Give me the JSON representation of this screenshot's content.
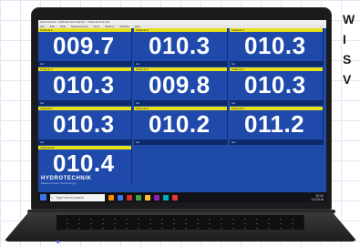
{
  "app": {
    "title_bar": "Hydrotechnik - HMG Remote Monitor - Channel Overview",
    "menu": [
      "File",
      "Edit",
      "View",
      "Measurement",
      "Tools",
      "Options",
      "Window",
      "Help"
    ]
  },
  "tiles": [
    {
      "header": "Channel 1",
      "value": "009.7",
      "unit": "bar"
    },
    {
      "header": "Channel 2",
      "value": "010.3",
      "unit": "bar"
    },
    {
      "header": "Channel 3",
      "value": "010.3",
      "unit": "bar"
    },
    {
      "header": "Channel 4",
      "value": "010.3",
      "unit": "bar"
    },
    {
      "header": "Channel 5",
      "value": "009.8",
      "unit": "bar"
    },
    {
      "header": "Channel 6",
      "value": "010.3",
      "unit": "bar"
    },
    {
      "header": "Channel 7",
      "value": "010.3",
      "unit": "bar"
    },
    {
      "header": "Channel 8",
      "value": "010.2",
      "unit": "bar"
    },
    {
      "header": "Channel 9",
      "value": "011.2",
      "unit": "bar"
    },
    {
      "header": "Channel 10",
      "value": "010.4",
      "unit": "bar"
    }
  ],
  "logo": {
    "brand": "HYDROTECHNIK",
    "tagline": "Measurement Technology"
  },
  "taskbar": {
    "search_placeholder": "Type here to search",
    "tray_time": "10:24",
    "tray_date": "1/1/2019",
    "app_icon_colors": [
      "#ff8a00",
      "#3b78e7",
      "#d32f2f",
      "#43a047",
      "#fbc02d",
      "#8e24aa",
      "#00acc1",
      "#e53935"
    ]
  },
  "side_text": [
    "W",
    "I",
    "S",
    "V"
  ],
  "colors": {
    "screen_background": "#1e4aa8",
    "tile_header": "#e8e21a",
    "value_text": "#ffffff"
  }
}
